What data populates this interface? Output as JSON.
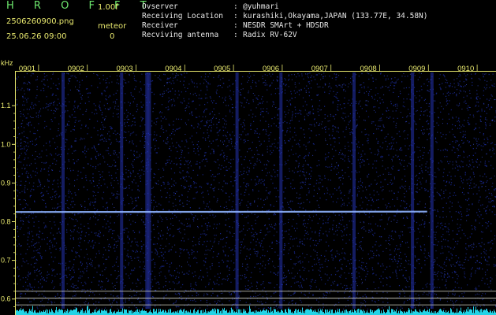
{
  "header": {
    "app_title": "H R O F F T",
    "version": "1.00f",
    "filename": "2506260900.png",
    "datetime": "25.06.26 09:00",
    "meteor_label": "meteor",
    "meteor_count": "0"
  },
  "info": [
    {
      "key": "Ovserver",
      "colon": ":",
      "value": "@yuhmari"
    },
    {
      "key": "Receiving Location",
      "colon": ":",
      "value": "kurashiki,Okayama,JAPAN (133.77E, 34.58N)"
    },
    {
      "key": "Receiver",
      "colon": ":",
      "value": "NESDR SMArt + HDSDR"
    },
    {
      "key": "Recviving antenna",
      "colon": ":",
      "value": "Radix RV-62V"
    }
  ],
  "colors": {
    "background": "#000000",
    "spectrum_noise": "#1a2a9a",
    "signal_trace": "#8fb4ff",
    "amplitude_bars": "#22d3e6",
    "label_yellow": "#e8e86e",
    "title_green": "#6ee86e",
    "guide_lines": "#d8d8c8"
  },
  "chart_data": {
    "type": "heatmap",
    "ylabel": "kHz",
    "y_ticks": [
      {
        "value": 1.1,
        "label": "1.1"
      },
      {
        "value": 1.0,
        "label": "1.0"
      },
      {
        "value": 0.9,
        "label": "0.9"
      },
      {
        "value": 0.8,
        "label": "0.8"
      },
      {
        "value": 0.7,
        "label": "0.7"
      },
      {
        "value": 0.6,
        "label": "0.6"
      }
    ],
    "ylim": [
      0.575,
      1.19
    ],
    "x_ticks": [
      "0901",
      "0902",
      "0903",
      "0904",
      "0905",
      "0906",
      "0907",
      "0908",
      "0909",
      "0910"
    ],
    "xlim_minutes": [
      0.5,
      10.5
    ],
    "signal_trace": {
      "freq_khz": 0.825,
      "end_freq_khz": 0.826,
      "start_minute": 0.5,
      "end_minute": 9.2
    },
    "guide_lines_khz": [
      0.62,
      0.602,
      0.585
    ],
    "vertical_streaks_minutes": [
      1.73,
      2.93,
      3.45,
      3.5,
      8.9,
      9.3,
      7.7,
      5.3,
      6.2
    ]
  }
}
